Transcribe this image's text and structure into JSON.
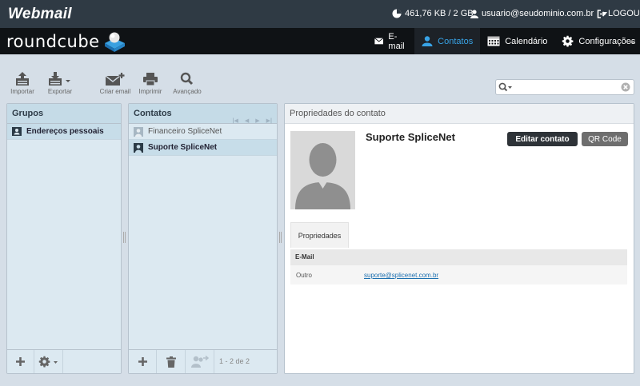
{
  "topbar": {
    "brand": "Webmail",
    "quota": "461,76 KB / 2 GB",
    "username": "usuario@seudominio.com.br",
    "logout": "LOGOUT"
  },
  "header": {
    "logo_text": "roundcube",
    "tasks": [
      {
        "label": "E-mail",
        "icon": "envelope-icon"
      },
      {
        "label": "Contatos",
        "icon": "person-icon",
        "active": true
      },
      {
        "label": "Calendário",
        "icon": "calendar-icon"
      },
      {
        "label": "Configurações",
        "icon": "gear-icon"
      }
    ]
  },
  "toolbar": {
    "import": "Importar",
    "export": "Exportar",
    "compose": "Criar email",
    "print": "Imprimir",
    "advanced": "Avançado"
  },
  "search": {
    "placeholder": "",
    "value": ""
  },
  "groups": {
    "title": "Grupos",
    "items": [
      {
        "label": "Endereços pessoais",
        "selected": true
      }
    ]
  },
  "contacts": {
    "title": "Contatos",
    "items": [
      {
        "label": "Financeiro SpliceNet",
        "selected": false
      },
      {
        "label": "Suporte SpliceNet",
        "selected": true
      }
    ],
    "count": "1 - 2 de 2"
  },
  "contact": {
    "frame_title": "Propriedades do contato",
    "name": "Suporte SpliceNet",
    "edit_label": "Editar contato",
    "qr_label": "QR Code",
    "tab": "Propriedades",
    "section": "E-Mail",
    "field_label": "Outro",
    "field_value": "suporte@splicenet.com.br"
  },
  "colors": {
    "topbar": "#2f3a44",
    "header": "#0f1215",
    "accent": "#38a3e6",
    "panel_head": "#c5dbe7",
    "list_bg": "#dce9f1"
  }
}
